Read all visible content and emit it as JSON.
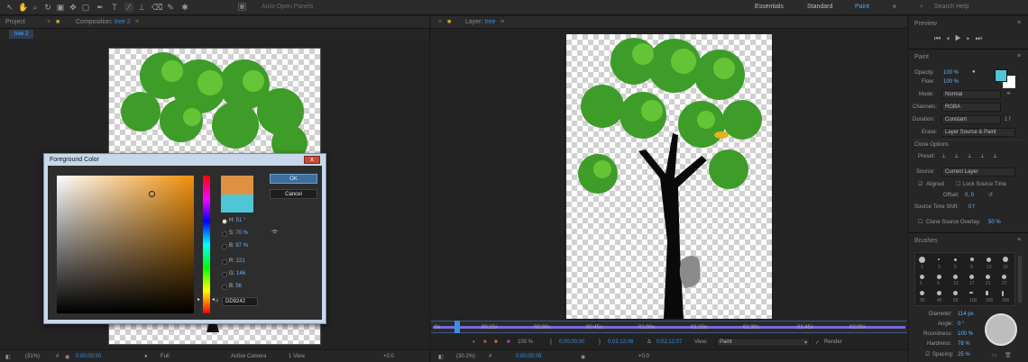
{
  "toolbar": {
    "auto_open_panels_label": "Auto-Open Panels",
    "workspaces": [
      "Essentials",
      "Standard",
      "Paint"
    ],
    "active_workspace": "Paint",
    "search_placeholder": "Search Help"
  },
  "left_panel": {
    "project_tab": "Project",
    "composition_tab_prefix": "Composition: ",
    "composition_name": "tree 2",
    "breadcrumb": "tree 2",
    "footer": {
      "zoom": "(31%)",
      "timecode": "0;00;00;00",
      "resolution": "Full",
      "camera": "Active Camera",
      "views": "1 View",
      "exposure": "+0.0"
    }
  },
  "dialog": {
    "title": "Foreground Color",
    "close_label": "x",
    "ok_label": "OK",
    "cancel_label": "Cancel",
    "fields": [
      {
        "label": "H:",
        "value": "51 °",
        "selected": true
      },
      {
        "label": "S:",
        "value": "70 %",
        "selected": false
      },
      {
        "label": "B:",
        "value": "87 %",
        "selected": false
      },
      {
        "label": "R:",
        "value": "221",
        "selected": false
      },
      {
        "label": "G:",
        "value": "146",
        "selected": false
      },
      {
        "label": "B:",
        "value": "56",
        "selected": false
      }
    ],
    "hex_label": "#",
    "hex_value": "DD9242",
    "new_color": "#dd9242",
    "old_color": "#4fc6d8"
  },
  "layer_panel": {
    "tab_prefix": "Layer: ",
    "layer_name": "tree",
    "time_ticks": [
      "0s",
      "00:15s",
      "00:30s",
      "00:45s",
      "01:00s",
      "01:15s",
      "01:30s",
      "01:45s",
      "02:00s"
    ],
    "controls": {
      "zoom_pct": "100 %",
      "timecode_in": "0;00;00;00",
      "timecode_out": "0;02;12;06",
      "duration": "0;02;12;07",
      "view_label": "View:",
      "view_value": "Paint",
      "render_label": "Render"
    },
    "footer": {
      "zoom": "(30.2%)",
      "timecode": "0;00;00;09",
      "exposure": "+0.0"
    }
  },
  "preview_panel": {
    "title": "Preview"
  },
  "paint_panel": {
    "title": "Paint",
    "opacity_label": "Opacity:",
    "opacity_value": "100 %",
    "flow_label": "Flow:",
    "flow_value": "100 %",
    "mode_label": "Mode:",
    "mode_value": "Normal",
    "channels_label": "Channels:",
    "channels_value": "RGBA",
    "duration_label": "Duration:",
    "duration_value": "Constant",
    "erase_label": "Erase:",
    "erase_value": "Layer Source & Paint",
    "clone_options_label": "Clone Options",
    "preset_label": "Preset:",
    "source_label": "Source:",
    "source_value": "Current Layer",
    "aligned_label": "Aligned",
    "lock_source_time_label": "Lock Source Time",
    "offset_label": "Offset:",
    "offset_value": "0, 0",
    "source_time_shift_label": "Source Time Shift:",
    "source_time_shift_value": "0 f",
    "clone_overlay_label": "Clone Source Overlay:",
    "clone_overlay_value": "50 %",
    "foreground_color": "#4fc6d8",
    "background_color": "#ffffff"
  },
  "brushes_panel": {
    "title": "Brushes",
    "diameter_label": "Diameter:",
    "diameter_value": "114 px",
    "angle_label": "Angle:",
    "angle_value": "0 °",
    "roundness_label": "Roundness:",
    "roundness_value": "100 %",
    "hardness_label": "Hardness:",
    "hardness_value": "78 %",
    "spacing_label": "Spacing:",
    "spacing_value": "25 %",
    "brush_sizes": [
      "1",
      "3",
      "5",
      "9",
      "13",
      "19",
      "5",
      "9",
      "13",
      "17",
      "21",
      "27",
      "35",
      "45",
      "65",
      "100",
      "200",
      "300"
    ]
  }
}
